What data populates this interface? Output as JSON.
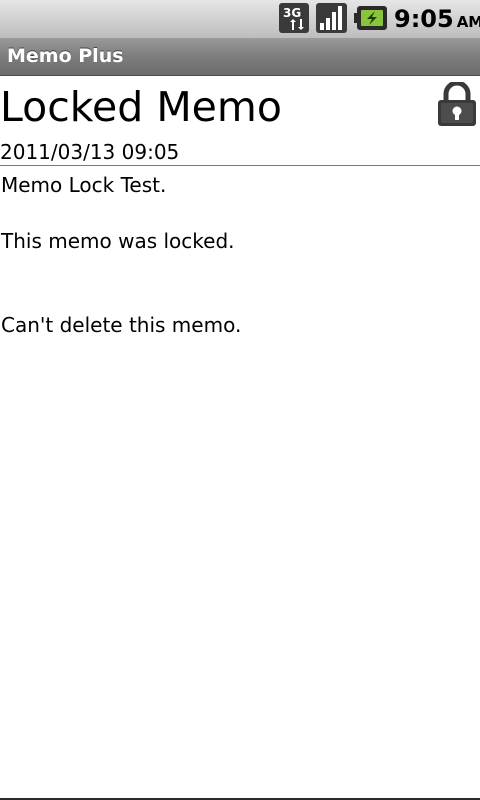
{
  "status_bar": {
    "network_icon": "3g-data-icon",
    "network_label": "3G",
    "signal_icon": "signal-strength-icon",
    "battery_icon": "battery-charging-icon",
    "time": "9:05",
    "ampm": "AM"
  },
  "app": {
    "title": "Memo Plus"
  },
  "memo": {
    "title": "Locked Memo",
    "date": "2011/03/13 09:05",
    "lock_icon": "lock-icon",
    "lines": [
      "Memo Lock Test.",
      "This memo was locked.",
      "Can't delete this memo."
    ]
  },
  "colors": {
    "title_bar": "#7d7d7d",
    "status_bar": "#cfcfcf",
    "battery_accent": "#8ac43f",
    "background": "#ffffff"
  }
}
